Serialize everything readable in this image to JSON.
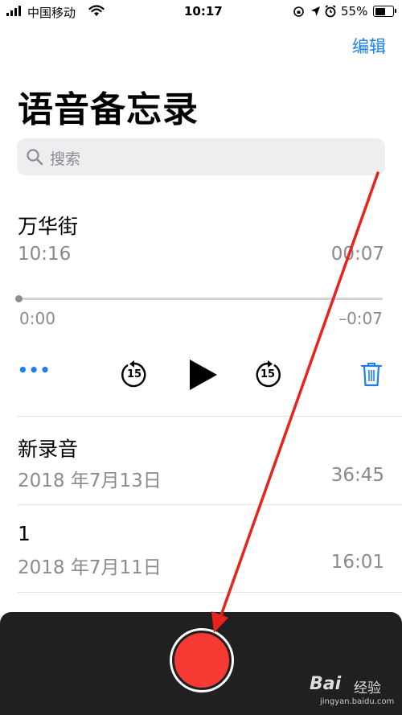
{
  "status_bar": {
    "carrier": "中国移动",
    "time": "10:17",
    "battery": "55%"
  },
  "header": {
    "edit_label": "编辑",
    "title": "语音备忘录"
  },
  "search": {
    "placeholder": "搜索"
  },
  "expanded_recording": {
    "title": "万华街",
    "time": "10:16",
    "duration": "00:07",
    "position": "0:00",
    "remaining": "–0:07",
    "skip_back_seconds": "15",
    "skip_forward_seconds": "15",
    "more_label": "•••",
    "progress": 0
  },
  "recordings": [
    {
      "title": "新录音",
      "date": "2018 年7月13日",
      "duration": "36:45"
    },
    {
      "title": "1",
      "date": "2018 年7月11日",
      "duration": "16:01"
    }
  ],
  "watermark": {
    "brand": "Bai",
    "brand_suffix": "经验",
    "url": "jingyan.baidu.com"
  },
  "colors": {
    "accent": "#1a7ef5",
    "record": "#f43a33",
    "annotation_arrow": "#e8221c"
  }
}
